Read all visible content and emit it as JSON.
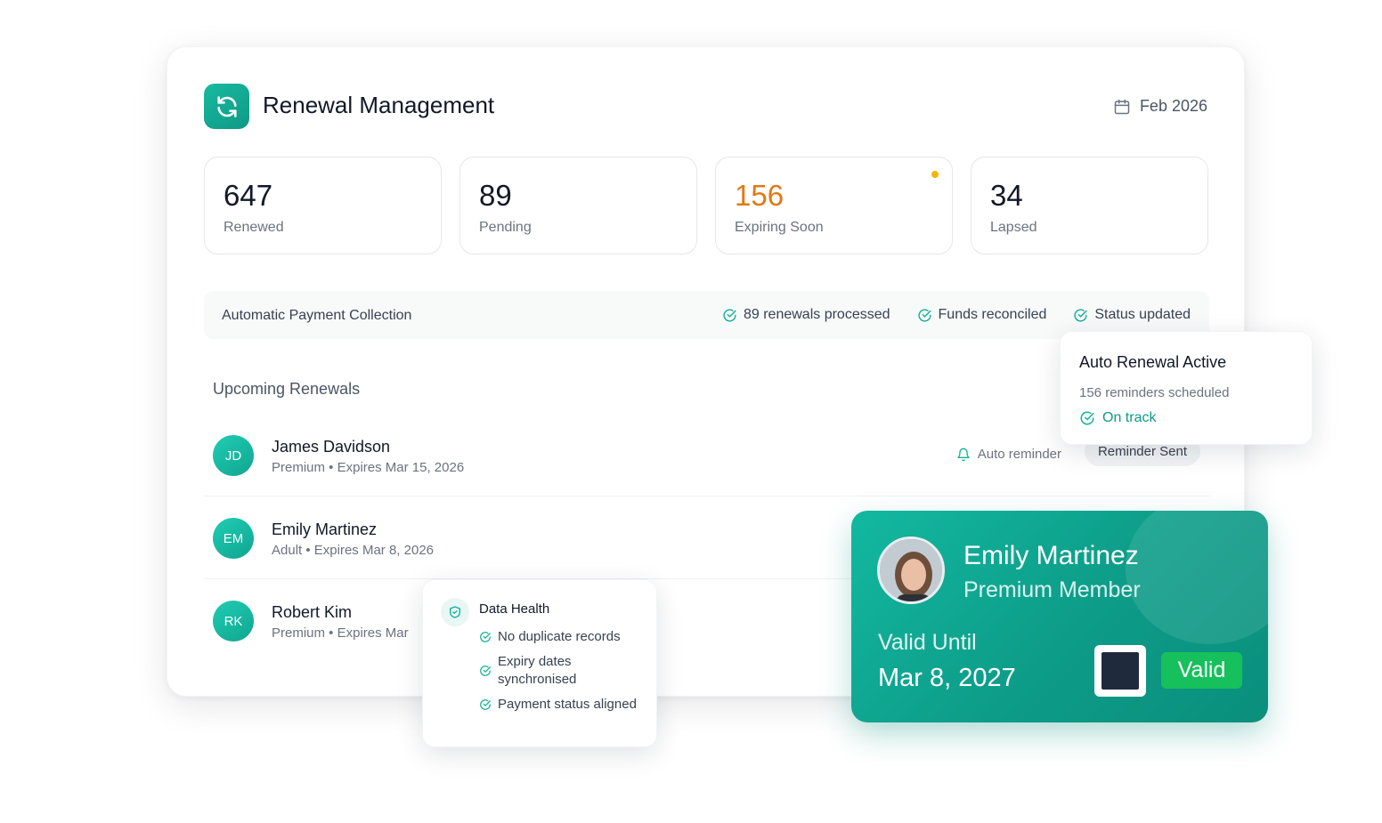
{
  "app": {
    "title": "Renewal Management",
    "date": "Feb 2026"
  },
  "stats": [
    {
      "value": "647",
      "label": "Renewed"
    },
    {
      "value": "89",
      "label": "Pending"
    },
    {
      "value": "156",
      "label": "Expiring Soon"
    },
    {
      "value": "34",
      "label": "Lapsed"
    }
  ],
  "payment": {
    "title": "Automatic Payment Collection",
    "items": [
      "89 renewals processed",
      "Funds reconciled",
      "Status updated"
    ]
  },
  "upcoming": {
    "title": "Upcoming Renewals",
    "rows": [
      {
        "initials": "JD",
        "name": "James Davidson",
        "meta": "Premium • Expires Mar 15, 2026",
        "reminder": "Auto reminder",
        "badge": "Reminder Sent"
      },
      {
        "initials": "EM",
        "name": "Emily Martinez",
        "meta": "Adult • Expires Mar 8, 2026"
      },
      {
        "initials": "RK",
        "name": "Robert Kim",
        "meta": "Premium • Expires Mar"
      }
    ]
  },
  "auto_renewal": {
    "title": "Auto Renewal Active",
    "subtitle": "156 reminders scheduled",
    "status": "On track"
  },
  "data_health": {
    "title": "Data Health",
    "items": [
      "No duplicate records",
      "Expiry dates synchronised",
      "Payment status aligned"
    ]
  },
  "member_card": {
    "name": "Emily Martinez",
    "tier": "Premium Member",
    "valid_label": "Valid Until",
    "valid_date": "Mar 8, 2027",
    "status": "Valid"
  },
  "colors": {
    "accent": "#13b09a",
    "warning": "#e07a14",
    "valid": "#16c05c"
  },
  "icons": {
    "logo": "refresh-icon",
    "date": "calendar-icon",
    "check": "check-circle-icon",
    "reminder": "bell-icon",
    "health": "shield-check-icon"
  }
}
